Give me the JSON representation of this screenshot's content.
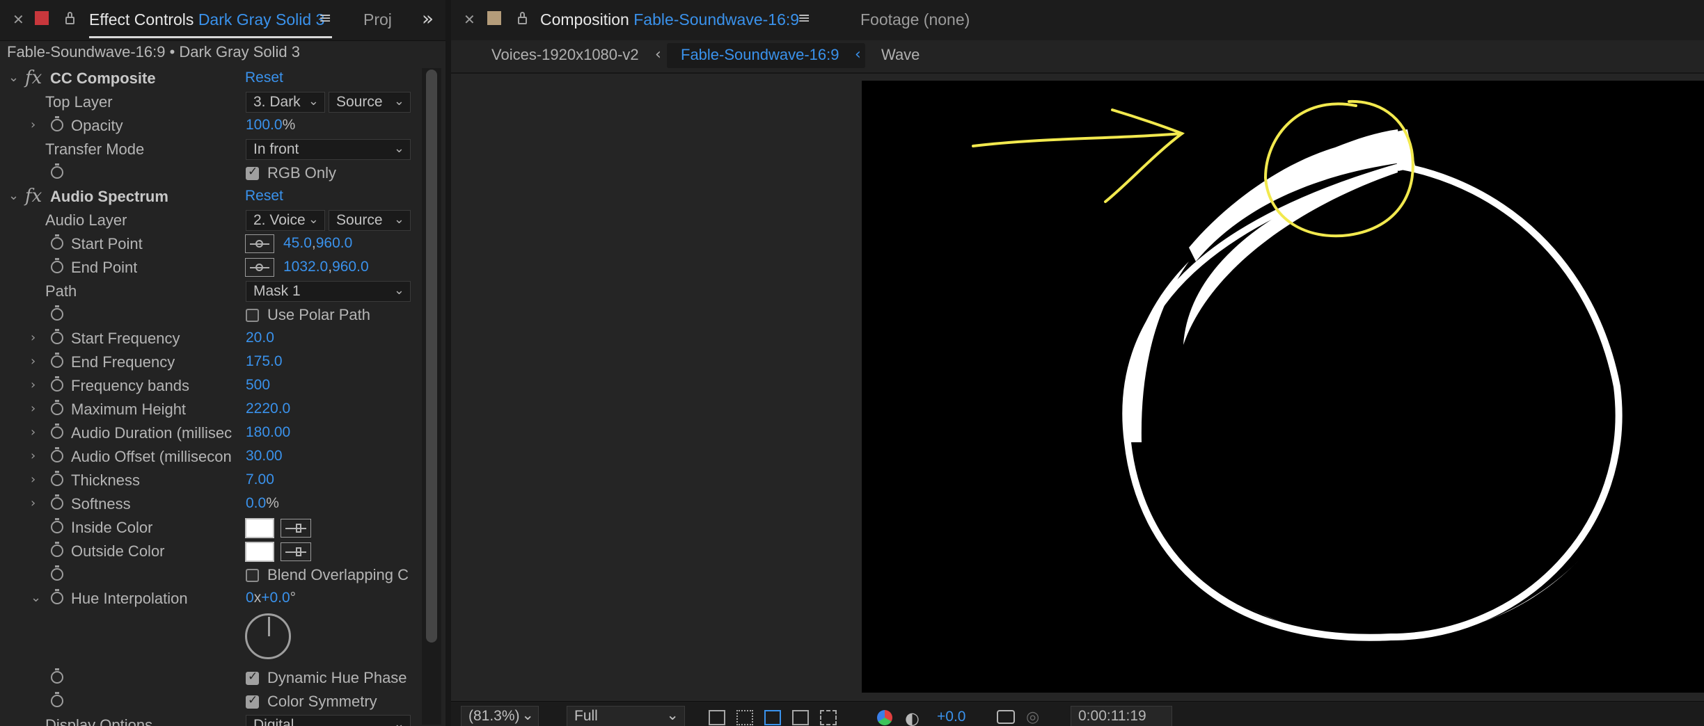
{
  "effect_controls": {
    "tab_label": "Effect Controls",
    "layer_name": "Dark Gray Solid 3",
    "next_tab": "Proj",
    "overflow": "»",
    "layer_line": "Fable-Soundwave-16:9 • Dark Gray Solid 3",
    "reset": "Reset",
    "cc_composite": {
      "name": "CC Composite",
      "top_layer_label": "Top Layer",
      "top_layer_value": "3. Dark",
      "top_layer_source": "Source",
      "opacity_label": "Opacity",
      "opacity_value": "100.0",
      "opacity_unit": "%",
      "transfer_mode_label": "Transfer Mode",
      "transfer_mode_value": "In front",
      "rgb_only_label": "RGB Only",
      "rgb_only_checked": true
    },
    "audio_spectrum": {
      "name": "Audio Spectrum",
      "audio_layer_label": "Audio Layer",
      "audio_layer_value": "2. Voice",
      "audio_layer_source": "Source",
      "start_point_label": "Start Point",
      "start_point_x": "45.0",
      "start_point_y": "960.0",
      "end_point_label": "End Point",
      "end_point_x": "1032.0",
      "end_point_y": "960.0",
      "comma": ",",
      "path_label": "Path",
      "path_value": "Mask 1",
      "use_polar_label": "Use Polar Path",
      "use_polar_checked": false,
      "start_freq_label": "Start Frequency",
      "start_freq_value": "20.0",
      "end_freq_label": "End Frequency",
      "end_freq_value": "175.0",
      "bands_label": "Frequency bands",
      "bands_value": "500",
      "max_height_label": "Maximum Height",
      "max_height_value": "2220.0",
      "duration_label": "Audio Duration (millisec",
      "duration_value": "180.00",
      "offset_label": "Audio Offset (millisecon",
      "offset_value": "30.00",
      "thickness_label": "Thickness",
      "thickness_value": "7.00",
      "softness_label": "Softness",
      "softness_value": "0.0",
      "softness_unit": "%",
      "inside_color_label": "Inside Color",
      "outside_color_label": "Outside Color",
      "inside_color": "#ffffff",
      "outside_color": "#ffffff",
      "blend_label": "Blend Overlapping C",
      "blend_checked": false,
      "hue_interp_label": "Hue Interpolation",
      "hue_rev": "0",
      "hue_x": "x",
      "hue_deg": "+0.0",
      "hue_deg_sym": "°",
      "dynamic_hue_label": "Dynamic Hue Phase",
      "dynamic_hue_checked": true,
      "color_sym_label": "Color Symmetry",
      "color_sym_checked": true,
      "display_options_label": "Display Options",
      "display_options_value": "Digital"
    }
  },
  "composition": {
    "tab_label": "Composition",
    "comp_name": "Fable-Soundwave-16:9",
    "footage_tab": "Footage (none)",
    "subtabs": [
      "Voices-1920x1080-v2",
      "Fable-Soundwave-16:9",
      "Wave"
    ],
    "active_subtab": "Fable-Soundwave-16:9",
    "annotation_color": "#f2e94e",
    "bottom": {
      "zoom": "(81.3%)",
      "resolution": "Full",
      "exposure": "+0.0",
      "timecode": "0:00:11:19"
    }
  },
  "colors": {
    "accent": "#3a92ec",
    "label_red": "#c8373c",
    "label_tan": "#b49c7a"
  }
}
